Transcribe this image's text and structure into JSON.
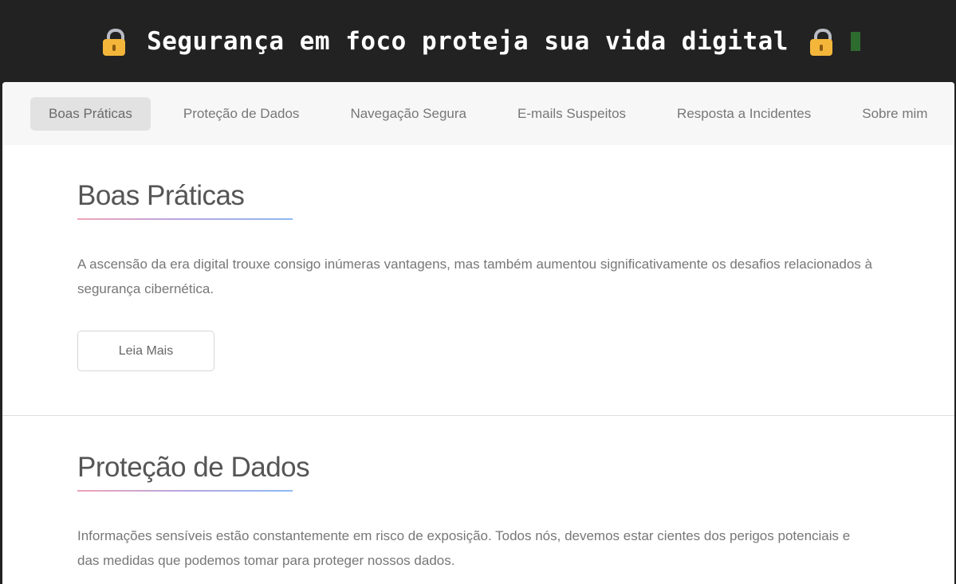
{
  "banner": {
    "title": "Segurança em foco proteja sua vida digital",
    "left_icon": "lock-icon",
    "right_icon": "lock-icon",
    "cursor_color": "#2e6b2e"
  },
  "nav": {
    "items": [
      {
        "label": "Boas Práticas",
        "active": true
      },
      {
        "label": "Proteção de Dados",
        "active": false
      },
      {
        "label": "Navegação Segura",
        "active": false
      },
      {
        "label": "E-mails Suspeitos",
        "active": false
      },
      {
        "label": "Resposta a Incidentes",
        "active": false
      },
      {
        "label": "Sobre mim",
        "active": false
      }
    ]
  },
  "sections": [
    {
      "title": "Boas Práticas",
      "text": "A ascensão da era digital trouxe consigo inúmeras vantagens, mas também aumentou significativamente os desafios relacionados à segurança cibernética.",
      "button_label": "Leia Mais"
    },
    {
      "title": "Proteção de Dados",
      "text": "Informações sensíveis estão constantemente em risco de exposição. Todos nós, devemos estar cientes dos perigos potenciais e das medidas que podemos tomar para proteger nossos dados."
    }
  ],
  "colors": {
    "banner_bg": "#222222",
    "nav_bg": "#f7f7f7",
    "nav_active_bg": "#e2e2e2",
    "underline_start": "#f0a4b6",
    "underline_end": "#8cbaf2"
  }
}
